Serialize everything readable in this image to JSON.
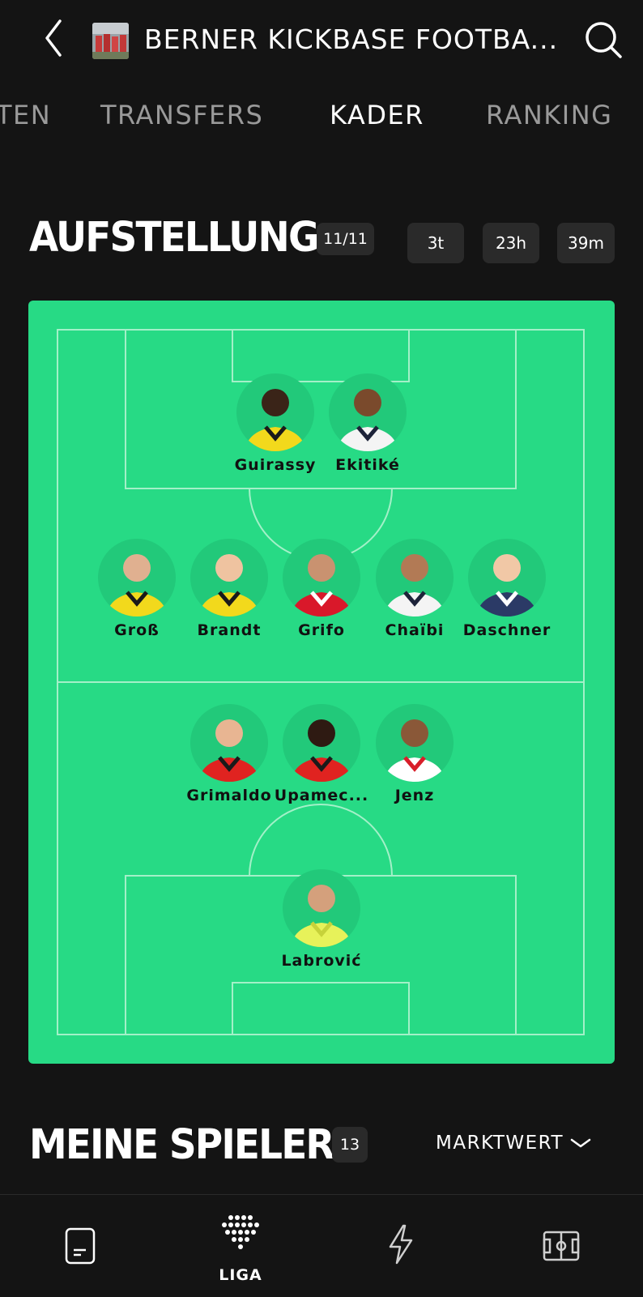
{
  "header": {
    "league_title": "BERNER KICKBASE FOOTBA...",
    "back_icon": "chevron-left-icon",
    "search_icon": "search-icon"
  },
  "tabs": [
    {
      "label": "TEN",
      "active": false
    },
    {
      "label": "TRANSFERS",
      "active": false
    },
    {
      "label": "KADER",
      "active": true
    },
    {
      "label": "RANKING",
      "active": false
    }
  ],
  "lineup": {
    "title": "AUFSTELLUNG",
    "count": "11/11",
    "countdown": [
      "3t",
      "23h",
      "39m"
    ]
  },
  "players": {
    "fw1": {
      "name": "Guirassy",
      "shirt": "#f2d91c",
      "shirt2": "#1a1a1a",
      "skin": "#3a2418"
    },
    "fw2": {
      "name": "Ekitiké",
      "shirt": "#f4f4f4",
      "shirt2": "#1d2339",
      "skin": "#7a4a2c"
    },
    "mf1": {
      "name": "Groß",
      "shirt": "#f2d91c",
      "shirt2": "#1a1a1a",
      "skin": "#e0b090"
    },
    "mf2": {
      "name": "Brandt",
      "shirt": "#f2d91c",
      "shirt2": "#1a1a1a",
      "skin": "#efc3a0"
    },
    "mf3": {
      "name": "Grifo",
      "shirt": "#d9182a",
      "shirt2": "#ffffff",
      "skin": "#c99270"
    },
    "mf4": {
      "name": "Chaïbi",
      "shirt": "#f4f4f4",
      "shirt2": "#1d2339",
      "skin": "#b27a55"
    },
    "mf5": {
      "name": "Daschner",
      "shirt": "#2b3a66",
      "shirt2": "#ffffff",
      "skin": "#f1c8a6"
    },
    "df1": {
      "name": "Grimaldo",
      "shirt": "#e02320",
      "shirt2": "#1a1a1a",
      "skin": "#e8b592"
    },
    "df2": {
      "name": "Upamec...",
      "shirt": "#e02320",
      "shirt2": "#1a1a1a",
      "skin": "#2e1a12"
    },
    "df3": {
      "name": "Jenz",
      "shirt": "#ffffff",
      "shirt2": "#d81f2a",
      "skin": "#8a5838"
    },
    "gk": {
      "name": "Labrović",
      "shirt": "#e7f25a",
      "shirt2": "#c7d23a",
      "skin": "#d4a07c"
    }
  },
  "my_players": {
    "title": "MEINE SPIELER",
    "count": "13",
    "sort_label": "MARKTWERT"
  },
  "bottom_nav": [
    {
      "icon": "document-icon",
      "label": ""
    },
    {
      "icon": "liga-dots-icon",
      "label": "LIGA"
    },
    {
      "icon": "lightning-icon",
      "label": ""
    },
    {
      "icon": "pitch-icon",
      "label": ""
    }
  ],
  "colors": {
    "background": "#141414",
    "pitch": "#27da85",
    "pill": "#2a2a2a",
    "inactive_tab": "#9a9a9a"
  }
}
